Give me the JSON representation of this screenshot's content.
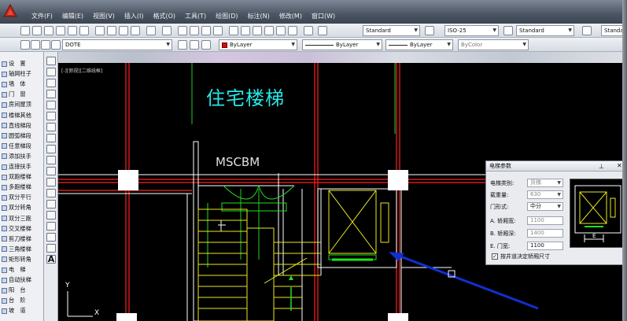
{
  "menu": {
    "items": [
      "文件(F)",
      "编辑(E)",
      "视图(V)",
      "插入(I)",
      "格式(O)",
      "工具(T)",
      "绘图(D)",
      "标注(N)",
      "修改(M)",
      "窗口(W)"
    ]
  },
  "toolbar1": {
    "text_style": "Standard",
    "dim_style": "ISO-25",
    "table_style": "Standard",
    "multileader_style": "Standard"
  },
  "toolbar2": {
    "layer": "DOTE",
    "color": "ByLayer",
    "linetype": "ByLayer",
    "lineweight": "ByLayer",
    "plot_style": "ByColor"
  },
  "palette": {
    "items": [
      "设　置",
      "轴网柱子",
      "墙　体",
      "门　窗",
      "房间屋顶",
      "楼梯其他",
      "直线梯段",
      "圆弧梯段",
      "任意梯段",
      "添加扶手",
      "连接扶手",
      "双跑楼梯",
      "多跑楼梯",
      "双分平行",
      "双分转角",
      "双分三跑",
      "交叉楼梯",
      "剪刀楼梯",
      "三角楼梯",
      "矩形转角",
      "电　梯",
      "自动扶梯",
      "阳　台",
      "台　阶",
      "坡　道"
    ]
  },
  "canvas": {
    "viewport_label": "[-][俯视][二维线框]",
    "title": "住宅楼梯",
    "room_label": "MSCBM",
    "axis_y": "Y",
    "axis_x": "X"
  },
  "elevator_panel": {
    "title": "电梯参数",
    "fields": [
      {
        "label": "电梯类别:",
        "value": "货梯"
      },
      {
        "label": "载重量:",
        "value": "630"
      },
      {
        "label": "门形式:",
        "value": "中分"
      },
      {
        "label": "A. 轿厢宽:",
        "value": "1100"
      },
      {
        "label": "B. 轿厢深:",
        "value": "1400"
      },
      {
        "label": "E. 门宽:",
        "value": "1100"
      }
    ],
    "checkbox_label": "按井道决定轿厢尺寸",
    "checkbox_checked": true,
    "preview_dim_label": "E"
  },
  "colors": {
    "canvas_bg": "#000000",
    "wall": "#ffffff",
    "axis_red": "#ff2020",
    "stair_yellow": "#e8e820",
    "door_green": "#20e020",
    "title_cyan": "#27e6e6",
    "arrow_blue": "#1030d0"
  }
}
